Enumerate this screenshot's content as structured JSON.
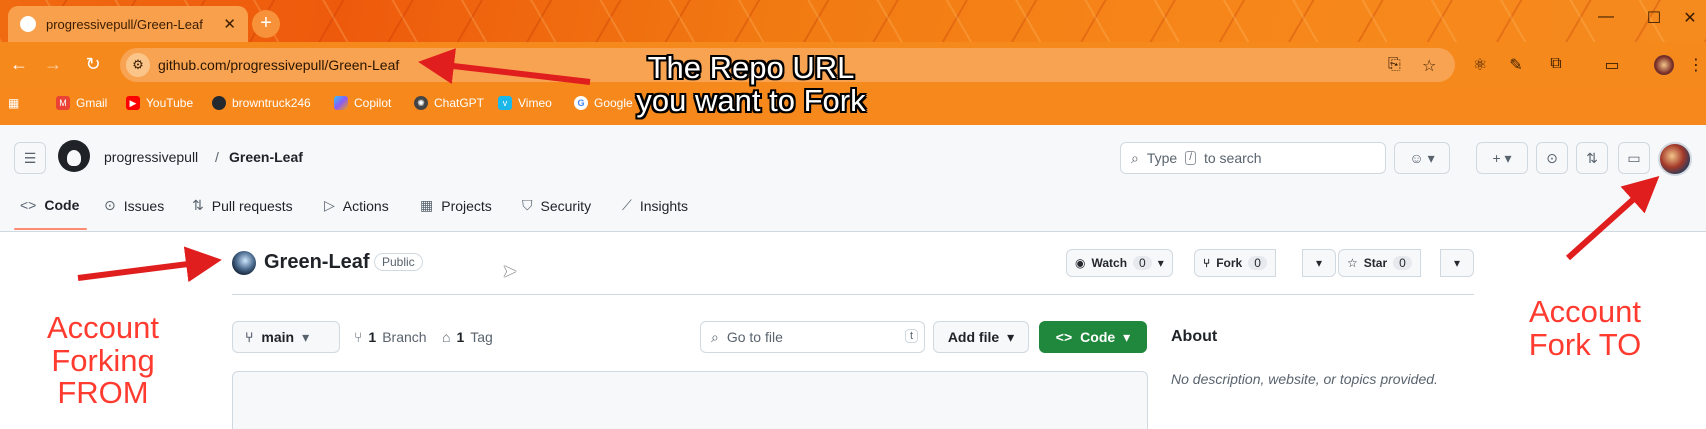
{
  "browser": {
    "tab_title": "progressivepull/Green-Leaf",
    "tab_close": "✕",
    "new_tab": "+",
    "url": "github.com/progressivepull/Green-Leaf",
    "bookmarks": [
      {
        "label": "Gmail",
        "color": "#ea4335"
      },
      {
        "label": "YouTube",
        "color": "#ff0000"
      },
      {
        "label": "browntruck246",
        "color": "#24292f"
      },
      {
        "label": "Copilot",
        "color": "#7f5af0"
      },
      {
        "label": "ChatGPT",
        "color": "#444444"
      },
      {
        "label": "Vimeo",
        "color": "#1ab7ea"
      },
      {
        "label": "Google",
        "color": "#4285f4"
      }
    ]
  },
  "github": {
    "owner": "progressivepull",
    "separator": "/",
    "repo": "Green-Leaf",
    "search_prefix": "Type",
    "search_key": "/",
    "search_suffix": "to search",
    "nav": [
      "Code",
      "Issues",
      "Pull requests",
      "Actions",
      "Projects",
      "Security",
      "Insights"
    ],
    "visibility": "Public",
    "watch": {
      "label": "Watch",
      "count": "0"
    },
    "fork": {
      "label": "Fork",
      "count": "0"
    },
    "star": {
      "label": "Star",
      "count": "0"
    },
    "branch": "main",
    "branch_count": "1",
    "branch_label": "Branch",
    "tag_count": "1",
    "tag_label": "Tag",
    "goto_placeholder": "Go to file",
    "goto_key": "t",
    "add_file": "Add file",
    "code_button": "Code",
    "about_heading": "About",
    "about_text": "No description, website, or topics provided."
  },
  "annotations": {
    "repo_url": [
      "The Repo URL",
      "you want to Fork"
    ],
    "from": [
      "Account",
      "Forking",
      "FROM"
    ],
    "to": [
      "Account",
      "Fork TO"
    ]
  }
}
